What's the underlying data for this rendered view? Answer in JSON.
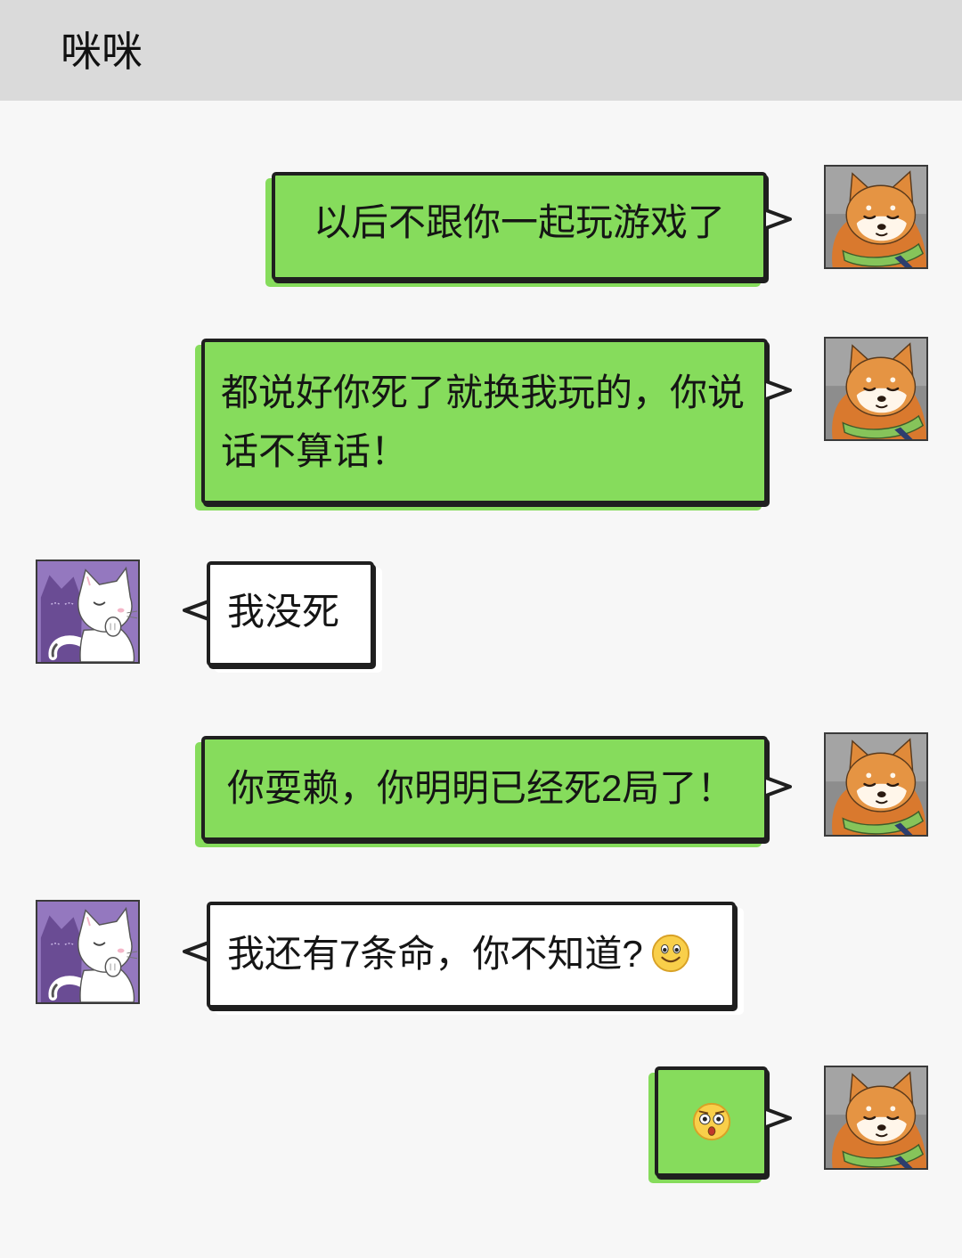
{
  "header": {
    "title": "咪咪"
  },
  "colors": {
    "header_bg": "#dadada",
    "chat_bg": "#f7f7f7",
    "sent_bubble": "#86dc5c",
    "received_bubble": "#ffffff",
    "border": "#1f1f1f"
  },
  "messages": [
    {
      "avatar_icon": "shiba-dog-avatar-icon",
      "text": "以后不跟你一起玩游戏了"
    },
    {
      "avatar_icon": "shiba-dog-avatar-icon",
      "text": "都说好你死了就换我玩的，你说话不算话！"
    },
    {
      "avatar_icon": "white-cat-avatar-icon",
      "text": "我没死"
    },
    {
      "avatar_icon": "shiba-dog-avatar-icon",
      "text": "你耍赖，你明明已经死2局了！"
    },
    {
      "avatar_icon": "white-cat-avatar-icon",
      "text": "我还有7条命，你不知道?",
      "emoji_icon": "smile-emoji-icon"
    },
    {
      "avatar_icon": "shiba-dog-avatar-icon",
      "emoji_icon": "shocked-emoji-icon"
    }
  ]
}
